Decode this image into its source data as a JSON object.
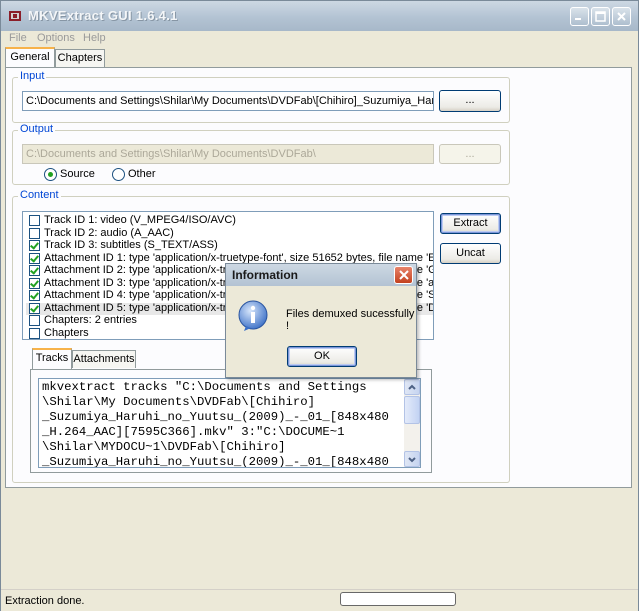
{
  "window": {
    "title": "MKVExtract GUI 1.6.4.1"
  },
  "menu": {
    "file": "File",
    "options": "Options",
    "help": "Help"
  },
  "tabs": {
    "general": "General",
    "chapters": "Chapters"
  },
  "input": {
    "legend": "Input",
    "path": "C:\\Documents and Settings\\Shilar\\My Documents\\DVDFab\\[Chihiro]_Suzumiya_Haruhi_n",
    "browse": "..."
  },
  "output": {
    "legend": "Output",
    "path": "C:\\Documents and Settings\\Shilar\\My Documents\\DVDFab\\",
    "browse": "...",
    "source": "Source",
    "other": "Other",
    "selected": "Source"
  },
  "content": {
    "legend": "Content",
    "extract": "Extract",
    "uncat": "Uncat",
    "items": [
      {
        "label": "Track ID 1: video (V_MPEG4/ISO/AVC)",
        "checked": false
      },
      {
        "label": "Track ID 2: audio (A_AAC)",
        "checked": false
      },
      {
        "label": "Track ID 3: subtitles (S_TEXT/ASS)",
        "checked": true
      },
      {
        "label": "Attachment ID 1: type 'application/x-truetype-font', size 51652 bytes, file name 'ELEPHNT",
        "checked": true
      },
      {
        "label": "Attachment ID 2: type 'application/x-truetype-font', size 64004 bytes, file name 'GOTHIC.TTF'",
        "checked": true
      },
      {
        "label": "Attachment ID 3: type 'application/x-truetype-font', size 50012 bytes, file name 'arialbd.ttf'",
        "checked": true
      },
      {
        "label": "Attachment ID 4: type 'application/x-truetype-font', size 41212 bytes, file name 'Stone",
        "checked": true
      },
      {
        "label": "Attachment ID 5: type 'application/x-truetype-font', size 38200 bytes, file name 'Dara",
        "checked": true
      },
      {
        "label": "Chapters: 2 entries",
        "checked": false
      },
      {
        "label": "Chapters",
        "checked": false
      }
    ]
  },
  "subtabs": {
    "tracks": "Tracks",
    "attachments": "Attachments"
  },
  "command": {
    "lines": [
      "mkvextract tracks \"C:\\Documents and Settings",
      "\\Shilar\\My Documents\\DVDFab\\[Chihiro]",
      "_Suzumiya_Haruhi_no_Yuutsu_(2009)_-_01_[848x480",
      "_H.264_AAC][7595C366].mkv\" 3:\"C:\\DOCUME~1",
      "\\Shilar\\MYDOCU~1\\DVDFab\\[Chihiro]",
      "_Suzumiya_Haruhi_no_Yuutsu_(2009)_-_01_[848x480"
    ]
  },
  "status": {
    "text": "Extraction done.",
    "progress": 0
  },
  "dialog": {
    "title": "Information",
    "message": "Files demuxed sucessfully !",
    "ok": "OK"
  }
}
